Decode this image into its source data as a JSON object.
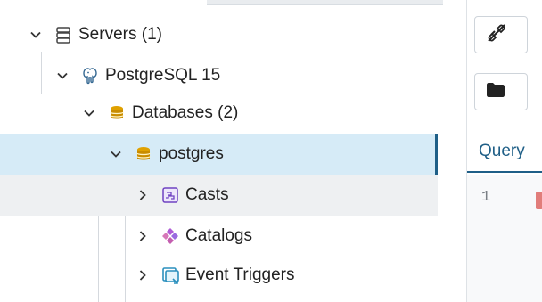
{
  "tree": {
    "items": [
      {
        "label": "Servers (1)",
        "icon": "servers-icon",
        "expanded": true
      },
      {
        "label": "PostgreSQL 15",
        "icon": "postgresql-elephant-icon",
        "expanded": true
      },
      {
        "label": "Databases (2)",
        "icon": "databases-icon",
        "expanded": true
      },
      {
        "label": "postgres",
        "icon": "database-icon",
        "expanded": true,
        "selected": true
      },
      {
        "label": "Casts",
        "icon": "casts-icon",
        "expanded": false
      },
      {
        "label": "Catalogs",
        "icon": "catalogs-icon",
        "expanded": false
      },
      {
        "label": "Event Triggers",
        "icon": "event-triggers-icon",
        "expanded": false
      }
    ]
  },
  "query_panel": {
    "tab_label": "Query",
    "line_number": "1",
    "toolbar_icons": [
      "disconnect-icon",
      "folder-icon"
    ]
  },
  "colors": {
    "selected_bg": "#d6ebf7",
    "accent": "#1f5f87",
    "database_gold": "#e0a100"
  }
}
